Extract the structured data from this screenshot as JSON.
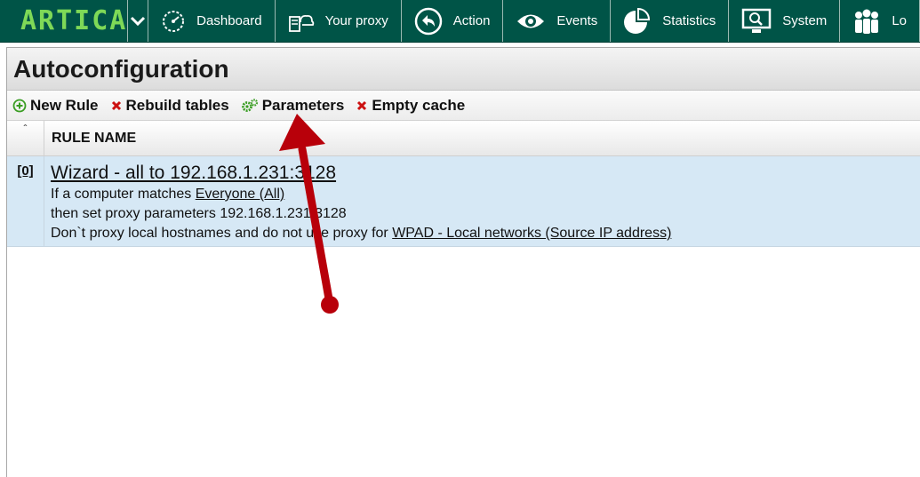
{
  "app": {
    "logo_text": "ARTICA"
  },
  "nav": {
    "items": [
      {
        "label": "Dashboard",
        "icon": "speedometer-icon"
      },
      {
        "label": "Your proxy",
        "icon": "proxy-server-cloud-icon"
      },
      {
        "label": "Action",
        "icon": "back-arrow-circle-icon"
      },
      {
        "label": "Events",
        "icon": "eye-icon"
      },
      {
        "label": "Statistics",
        "icon": "pie-chart-icon"
      },
      {
        "label": "System",
        "icon": "monitor-icon"
      },
      {
        "label": "Lo",
        "icon": "users-icon"
      }
    ]
  },
  "page": {
    "title": "Autoconfiguration"
  },
  "toolbar": {
    "new_rule": "New Rule",
    "rebuild_tables": "Rebuild tables",
    "parameters": "Parameters",
    "empty_cache": "Empty cache"
  },
  "table": {
    "sort_indicator": "ˆ",
    "column_header": "RULE NAME",
    "rows": [
      {
        "id": "[0]",
        "title": "Wizard - all to 192.168.1.231:3128",
        "line1_prefix": "If a computer matches ",
        "line1_link": "Everyone (All)",
        "line2": "then set proxy parameters 192.168.1.231:3128",
        "line3_prefix": "Don`t proxy local hostnames and do not use proxy for ",
        "line3_link": "WPAD - Local networks (Source IP address)"
      }
    ]
  },
  "colors": {
    "topbar": "#005447",
    "logo": "#7ed957",
    "row_highlight": "#d6e8f5",
    "add_icon": "#3a9d23",
    "remove_icon": "#cc1111",
    "annotation_arrow": "#b8000a"
  }
}
